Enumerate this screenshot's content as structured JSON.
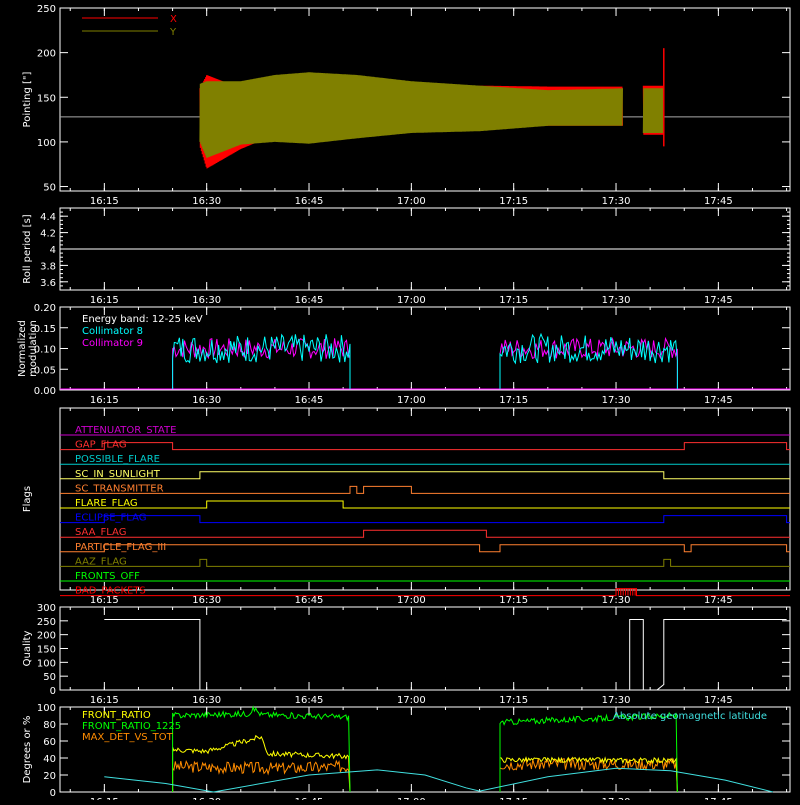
{
  "chart_data": [
    {
      "id": "pointing",
      "type": "line",
      "ylabel": "Pointing [\"]",
      "ylim": [
        45,
        250
      ],
      "yticks": [
        50,
        100,
        150,
        200,
        250
      ],
      "xticks": [
        "16:15",
        "16:30",
        "16:45",
        "17:00",
        "17:15",
        "17:30",
        "17:45"
      ],
      "legend": "top-left",
      "series": [
        {
          "name": "X",
          "color": "#ff0000"
        },
        {
          "name": "Y",
          "color": "#808000"
        }
      ],
      "envelope": [
        {
          "t": "16:29",
          "x": [
            95,
            160
          ],
          "y": [
            100,
            165
          ]
        },
        {
          "t": "16:30",
          "x": [
            70,
            175
          ],
          "y": [
            82,
            168
          ]
        },
        {
          "t": "16:35",
          "x": [
            92,
            160
          ],
          "y": [
            97,
            168
          ]
        },
        {
          "t": "16:40",
          "x": [
            108,
            152
          ],
          "y": [
            100,
            175
          ]
        },
        {
          "t": "16:45",
          "x": [
            116,
            148
          ],
          "y": [
            98,
            178
          ]
        },
        {
          "t": "16:52",
          "x": [
            122,
            150
          ],
          "y": [
            104,
            175
          ]
        },
        {
          "t": "17:00",
          "x": [
            122,
            158
          ],
          "y": [
            110,
            168
          ]
        },
        {
          "t": "17:10",
          "x": [
            115,
            163
          ],
          "y": [
            112,
            163
          ]
        },
        {
          "t": "17:20",
          "x": [
            118,
            162
          ],
          "y": [
            118,
            158
          ]
        },
        {
          "t": "17:31",
          "x": [
            118,
            162
          ],
          "y": [
            118,
            160
          ]
        }
      ],
      "envelope2": [
        {
          "t": "17:34",
          "x": [
            108,
            163
          ],
          "y": [
            110,
            160
          ]
        },
        {
          "t": "17:37",
          "x": [
            108,
            163
          ],
          "y": [
            110,
            160
          ]
        }
      ],
      "reference_level": 128,
      "spike": {
        "t": "17:37",
        "value": 205
      }
    },
    {
      "id": "roll",
      "type": "line",
      "ylabel": "Roll period [s]",
      "ylim": [
        3.5,
        4.5
      ],
      "yticks": [
        3.6,
        3.8,
        4.0,
        4.2,
        4.4
      ],
      "xticks": [
        "16:15",
        "16:30",
        "16:45",
        "17:00",
        "17:15",
        "17:30",
        "17:45"
      ],
      "value": 4.0
    },
    {
      "id": "modulation",
      "type": "line",
      "ylabel": "Normalized modulation",
      "ylim": [
        0,
        0.2
      ],
      "yticks": [
        "0.00",
        "0.05",
        "0.10",
        "0.15",
        "0.20"
      ],
      "xticks": [
        "16:15",
        "16:30",
        "16:45",
        "17:00",
        "17:15",
        "17:30",
        "17:45"
      ],
      "annotation": "Energy band: 12-25 keV",
      "series": [
        {
          "name": "Collimator 8",
          "color": "#00ffff"
        },
        {
          "name": "Collimator 9",
          "color": "#ff00ff"
        }
      ],
      "intervals": [
        [
          "16:25",
          "16:51"
        ],
        [
          "17:13",
          "17:39"
        ]
      ],
      "level": 0.1
    },
    {
      "id": "flags",
      "type": "line",
      "ylabel": "Flags",
      "xticks": [
        "16:15",
        "16:30",
        "16:45",
        "17:00",
        "17:15",
        "17:30",
        "17:45"
      ],
      "rows": [
        {
          "name": "ATTENUATOR_STATE",
          "color": "#cc00cc",
          "high": []
        },
        {
          "name": "GAP_FLAG",
          "color": "#ff3030",
          "high": [
            [
              "16:15",
              "16:25"
            ],
            [
              "17:40",
              "17:55"
            ]
          ]
        },
        {
          "name": "POSSIBLE_FLARE",
          "color": "#00cccc",
          "high": []
        },
        {
          "name": "SC_IN_SUNLIGHT",
          "color": "#ffff66",
          "high": [
            [
              "16:29",
              "17:37"
            ]
          ]
        },
        {
          "name": "SC_TRANSMITTER",
          "color": "#ff8030",
          "high": [
            [
              "16:51",
              "16:52"
            ],
            [
              "16:53",
              "17:00"
            ]
          ]
        },
        {
          "name": "FLARE_FLAG",
          "color": "#ffff00",
          "high": [
            [
              "16:30",
              "16:50"
            ]
          ]
        },
        {
          "name": "ECLIPSE_FLAG",
          "color": "#0000ff",
          "high": [
            [
              "16:15",
              "16:29"
            ],
            [
              "17:37",
              "17:55"
            ]
          ]
        },
        {
          "name": "SAA_FLAG",
          "color": "#ff3030",
          "high": [
            [
              "16:53",
              "17:11"
            ]
          ]
        },
        {
          "name": "PARTICLE_FLAG_III",
          "color": "#ff8030",
          "high": [
            [
              "16:15",
              "17:10"
            ],
            [
              "17:13",
              "17:40"
            ],
            [
              "17:41",
              "17:55"
            ]
          ]
        },
        {
          "name": "AAZ_FLAG",
          "color": "#808000",
          "high": [
            [
              "16:29",
              "16:30"
            ],
            [
              "17:37",
              "17:38"
            ]
          ]
        },
        {
          "name": "FRONTS_OFF",
          "color": "#00ff00",
          "high": []
        },
        {
          "name": "BAD_PACKETS",
          "color": "#ff0000",
          "high": [
            [
              "17:30",
              "17:33"
            ]
          ]
        }
      ]
    },
    {
      "id": "quality",
      "type": "line",
      "ylabel": "Quality",
      "ylim": [
        0,
        300
      ],
      "yticks": [
        0,
        50,
        100,
        150,
        200,
        250,
        300
      ],
      "xticks": [
        "16:15",
        "16:30",
        "16:45",
        "17:00",
        "17:15",
        "17:30",
        "17:45"
      ],
      "steps": [
        [
          "16:15",
          255
        ],
        [
          "16:29",
          255
        ],
        [
          "16:29",
          0
        ],
        [
          "17:32",
          0
        ],
        [
          "17:32",
          255
        ],
        [
          "17:34",
          255
        ],
        [
          "17:34",
          0
        ],
        [
          "17:36",
          0
        ],
        [
          "17:37",
          20
        ],
        [
          "17:37",
          255
        ],
        [
          "17:55",
          255
        ]
      ]
    },
    {
      "id": "ratios",
      "type": "line",
      "ylabel": "Degrees or %",
      "ylim": [
        0,
        100
      ],
      "yticks": [
        0,
        20,
        40,
        60,
        80,
        100
      ],
      "xticks": [
        "16:15",
        "16:30",
        "16:45",
        "17:00",
        "17:15",
        "17:30",
        "17:45"
      ],
      "legend": "top-left",
      "series": [
        {
          "name": "FRONT_RATIO",
          "color": "#ffff00"
        },
        {
          "name": "FRONT_RATIO_1225",
          "color": "#00ff00"
        },
        {
          "name": "MAX_DET_VS_TOT",
          "color": "#ff8c00"
        },
        {
          "name": "Absolute geomagnetic latitude",
          "color": "#40e0e0"
        }
      ],
      "front_ratio": {
        "intervals": [
          [
            "16:25",
            "16:51"
          ],
          [
            "17:13",
            "17:39"
          ]
        ],
        "levels": [
          [
            "16:25",
            50
          ],
          [
            "16:30",
            48
          ],
          [
            "16:38",
            65
          ],
          [
            "16:39",
            45
          ],
          [
            "16:51",
            42
          ],
          [
            "17:13",
            38
          ],
          [
            "17:39",
            37
          ]
        ]
      },
      "front_ratio_1225": {
        "levels": [
          [
            "16:25",
            90
          ],
          [
            "16:36",
            92
          ],
          [
            "16:37",
            98
          ],
          [
            "16:38",
            91
          ],
          [
            "16:51",
            88
          ],
          [
            "17:13",
            82
          ],
          [
            "17:39",
            90
          ]
        ]
      },
      "max_det": {
        "levels": [
          [
            "16:25",
            30
          ],
          [
            "16:40",
            28
          ],
          [
            "16:51",
            30
          ],
          [
            "17:13",
            33
          ],
          [
            "17:39",
            33
          ]
        ]
      },
      "latitude": [
        [
          "16:15",
          18
        ],
        [
          "16:24",
          10
        ],
        [
          "16:31",
          0
        ],
        [
          "16:45",
          20
        ],
        [
          "16:55",
          26
        ],
        [
          "17:02",
          20
        ],
        [
          "17:08",
          5
        ],
        [
          "17:10",
          1
        ],
        [
          "17:20",
          18
        ],
        [
          "17:30",
          28
        ],
        [
          "17:38",
          25
        ],
        [
          "17:46",
          14
        ],
        [
          "17:53",
          0
        ]
      ]
    }
  ]
}
